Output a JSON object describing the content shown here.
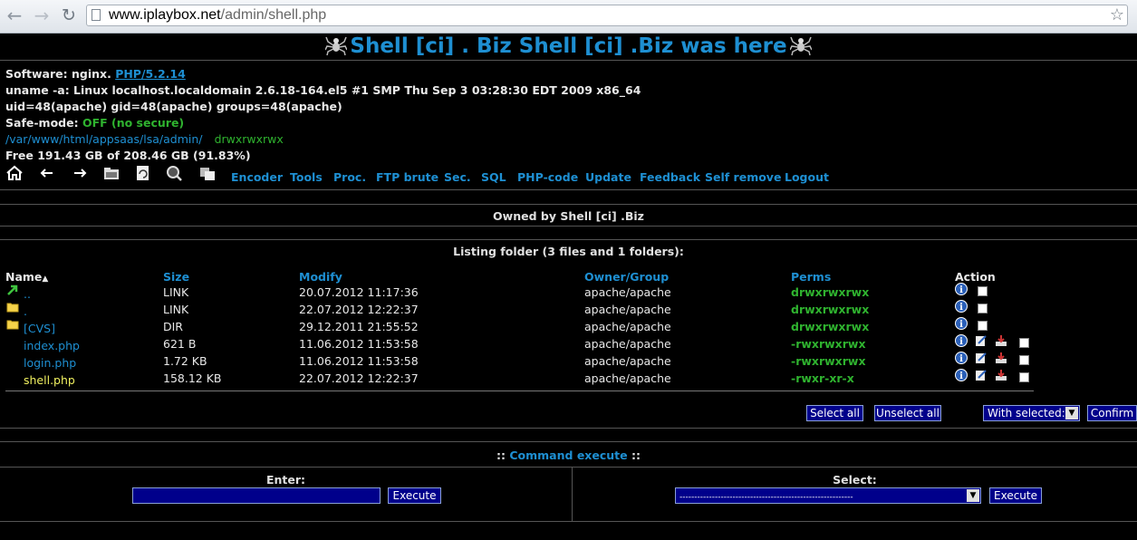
{
  "browser": {
    "url_host": "www.iplaybox.net",
    "url_path": "/admin/shell.php"
  },
  "header": {
    "title": "Shell [ci] . Biz Shell [ci] .Biz was here"
  },
  "info": {
    "software_label": "Software: nginx.",
    "php_link": "PHP/5.2.14",
    "uname": "uname -a: Linux localhost.localdomain 2.6.18-164.el5 #1 SMP Thu Sep 3 03:28:30 EDT 2009 x86_64",
    "uid": "uid=48(apache) gid=48(apache) groups=48(apache)",
    "safe_mode_label": "Safe-mode:",
    "safe_mode_value": "OFF (no secure)",
    "path": "/var/www/html/appsaas/lsa/admin/",
    "path_perms": "drwxrwxrwx",
    "free": "Free 191.43 GB of 208.46 GB (91.83%)"
  },
  "toolbar": {
    "icons": [
      "home-icon",
      "back-icon",
      "forward-icon",
      "buffer-icon",
      "refresh-icon",
      "search-icon",
      "buffer-paste-icon"
    ],
    "links": [
      "Encoder",
      "Tools",
      "Proc.",
      "FTP brute",
      "Sec.",
      "SQL",
      "PHP-code",
      "Update",
      "Feedback",
      "Self remove",
      "Logout"
    ]
  },
  "owned_by": "Owned by Shell [ci] .Biz",
  "listing": {
    "heading": "Listing folder (3 files and 1 folders):",
    "columns": {
      "name": "Name",
      "sort_mark": "▲",
      "size": "Size",
      "modify": "Modify",
      "owner": "Owner/Group",
      "perms": "Perms",
      "action": "Action"
    },
    "rows": [
      {
        "name": "..",
        "size": "LINK",
        "modify": "20.07.2012 11:17:36",
        "owner": "apache/apache",
        "perms": "drwxrwxrwx"
      },
      {
        "name": ".",
        "size": "LINK",
        "modify": "22.07.2012 12:22:37",
        "owner": "apache/apache",
        "perms": "drwxrwxrwx"
      },
      {
        "name": "[CVS]",
        "size": "DIR",
        "modify": "29.12.2011 21:55:52",
        "owner": "apache/apache",
        "perms": "drwxrwxrwx"
      },
      {
        "name": "index.php",
        "size": "621 B",
        "modify": "11.06.2012 11:53:58",
        "owner": "apache/apache",
        "perms": "-rwxrwxrwx"
      },
      {
        "name": "login.php",
        "size": "1.72 KB",
        "modify": "11.06.2012 11:53:58",
        "owner": "apache/apache",
        "perms": "-rwxrwxrwx"
      },
      {
        "name": "shell.php",
        "size": "158.12 KB",
        "modify": "22.07.2012 12:22:37",
        "owner": "apache/apache",
        "perms": "-rwxr-xr-x"
      }
    ],
    "select_all": "Select all",
    "unselect_all": "Unselect all",
    "with_selected": "With selected:",
    "confirm": "Confirm"
  },
  "command": {
    "prefix": "::",
    "title": "Command execute",
    "suffix": "::",
    "enter_label": "Enter:",
    "execute_left": "Execute",
    "select_label": "Select:",
    "select_value": "-----------------------------------------------------------",
    "execute_right": "Execute"
  },
  "colors": {
    "accent": "#1e8fd2",
    "green": "#2fb32f",
    "button_bg": "#00008b"
  }
}
